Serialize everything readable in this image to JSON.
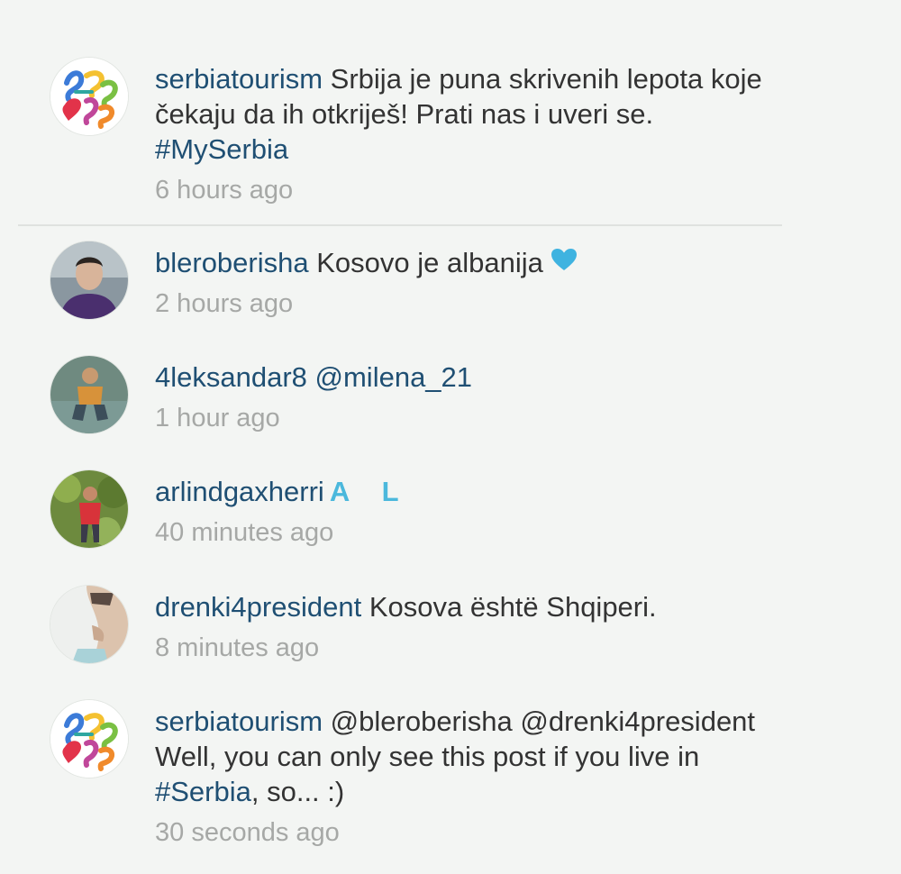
{
  "comments": [
    {
      "username": "serbiatourism",
      "segments": [
        {
          "text": " Srbija je puna skrivenih lepota koje čekaju da ih otkriješ! Prati nas i uveri se. "
        },
        {
          "text": "#MySerbia",
          "tag": true
        }
      ],
      "time": "6 hours ago",
      "avatar_icon": "serbia-tourism-logo"
    },
    {
      "username": "bleroberisha",
      "segments": [
        {
          "text": " Kosovo je albanija"
        }
      ],
      "emoji": "blue-heart",
      "time": "2 hours ago",
      "avatar_icon": "profile-photo-man-purple-shirt"
    },
    {
      "username": "4leksandar8",
      "segments": [
        {
          "text": " @milena_21"
        }
      ],
      "time": "1 hour ago",
      "avatar_icon": "profile-photo-man-sitting"
    },
    {
      "username": "arlindgaxherri",
      "segments": [],
      "emoji_text": "A L",
      "time": "40 minutes ago",
      "avatar_icon": "profile-photo-man-red-shirt-trees"
    },
    {
      "username": "drenki4president",
      "segments": [
        {
          "text": " Kosova është Shqiperi."
        }
      ],
      "time": "8 minutes ago",
      "avatar_icon": "profile-photo-face-side"
    },
    {
      "username": "serbiatourism",
      "segments": [
        {
          "text": " @bleroberisha @drenki4president Well, you can only see this post if you live in "
        },
        {
          "text": "#Serbia",
          "tag": true
        },
        {
          "text": ", so... :)"
        }
      ],
      "time": "30 seconds ago",
      "avatar_icon": "serbia-tourism-logo"
    }
  ],
  "colors": {
    "username": "#1f4f73",
    "timestamp": "#a6a8a6",
    "accent_blue": "#4bb8dc",
    "background": "#f3f5f3"
  }
}
